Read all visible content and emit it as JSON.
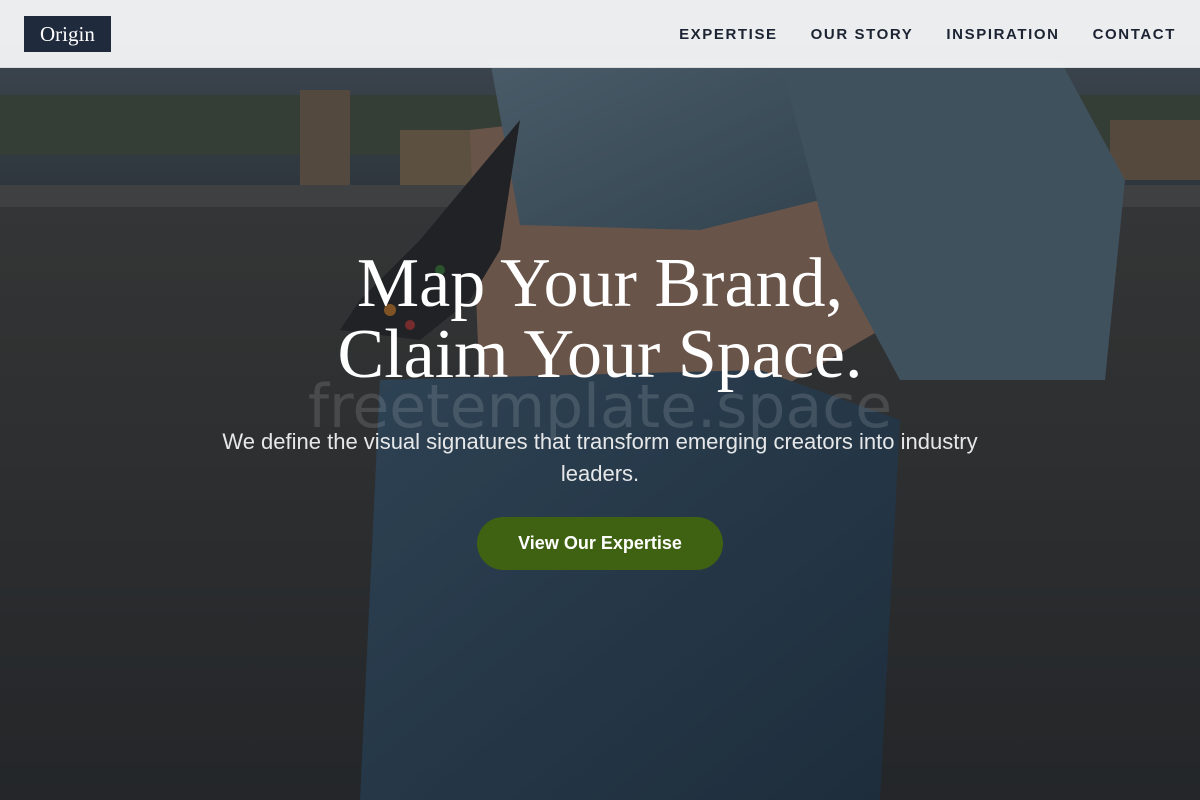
{
  "header": {
    "logo": "Origin",
    "nav": [
      {
        "label": "EXPERTISE"
      },
      {
        "label": "OUR STORY"
      },
      {
        "label": "INSPIRATION"
      },
      {
        "label": "CONTACT"
      }
    ]
  },
  "hero": {
    "title_line1": "Map Your Brand,",
    "title_line2": "Claim Your Space.",
    "watermark": "freetemplate.space",
    "subtitle": "We define the visual signatures that transform emerging creators into industry leaders.",
    "cta_label": "View Our Expertise"
  },
  "colors": {
    "logo_bg": "#1f2a3d",
    "nav_text": "#1c2433",
    "header_bg": "#f3f4f5",
    "cta_bg": "#3f6212",
    "hero_text": "#ffffff"
  }
}
